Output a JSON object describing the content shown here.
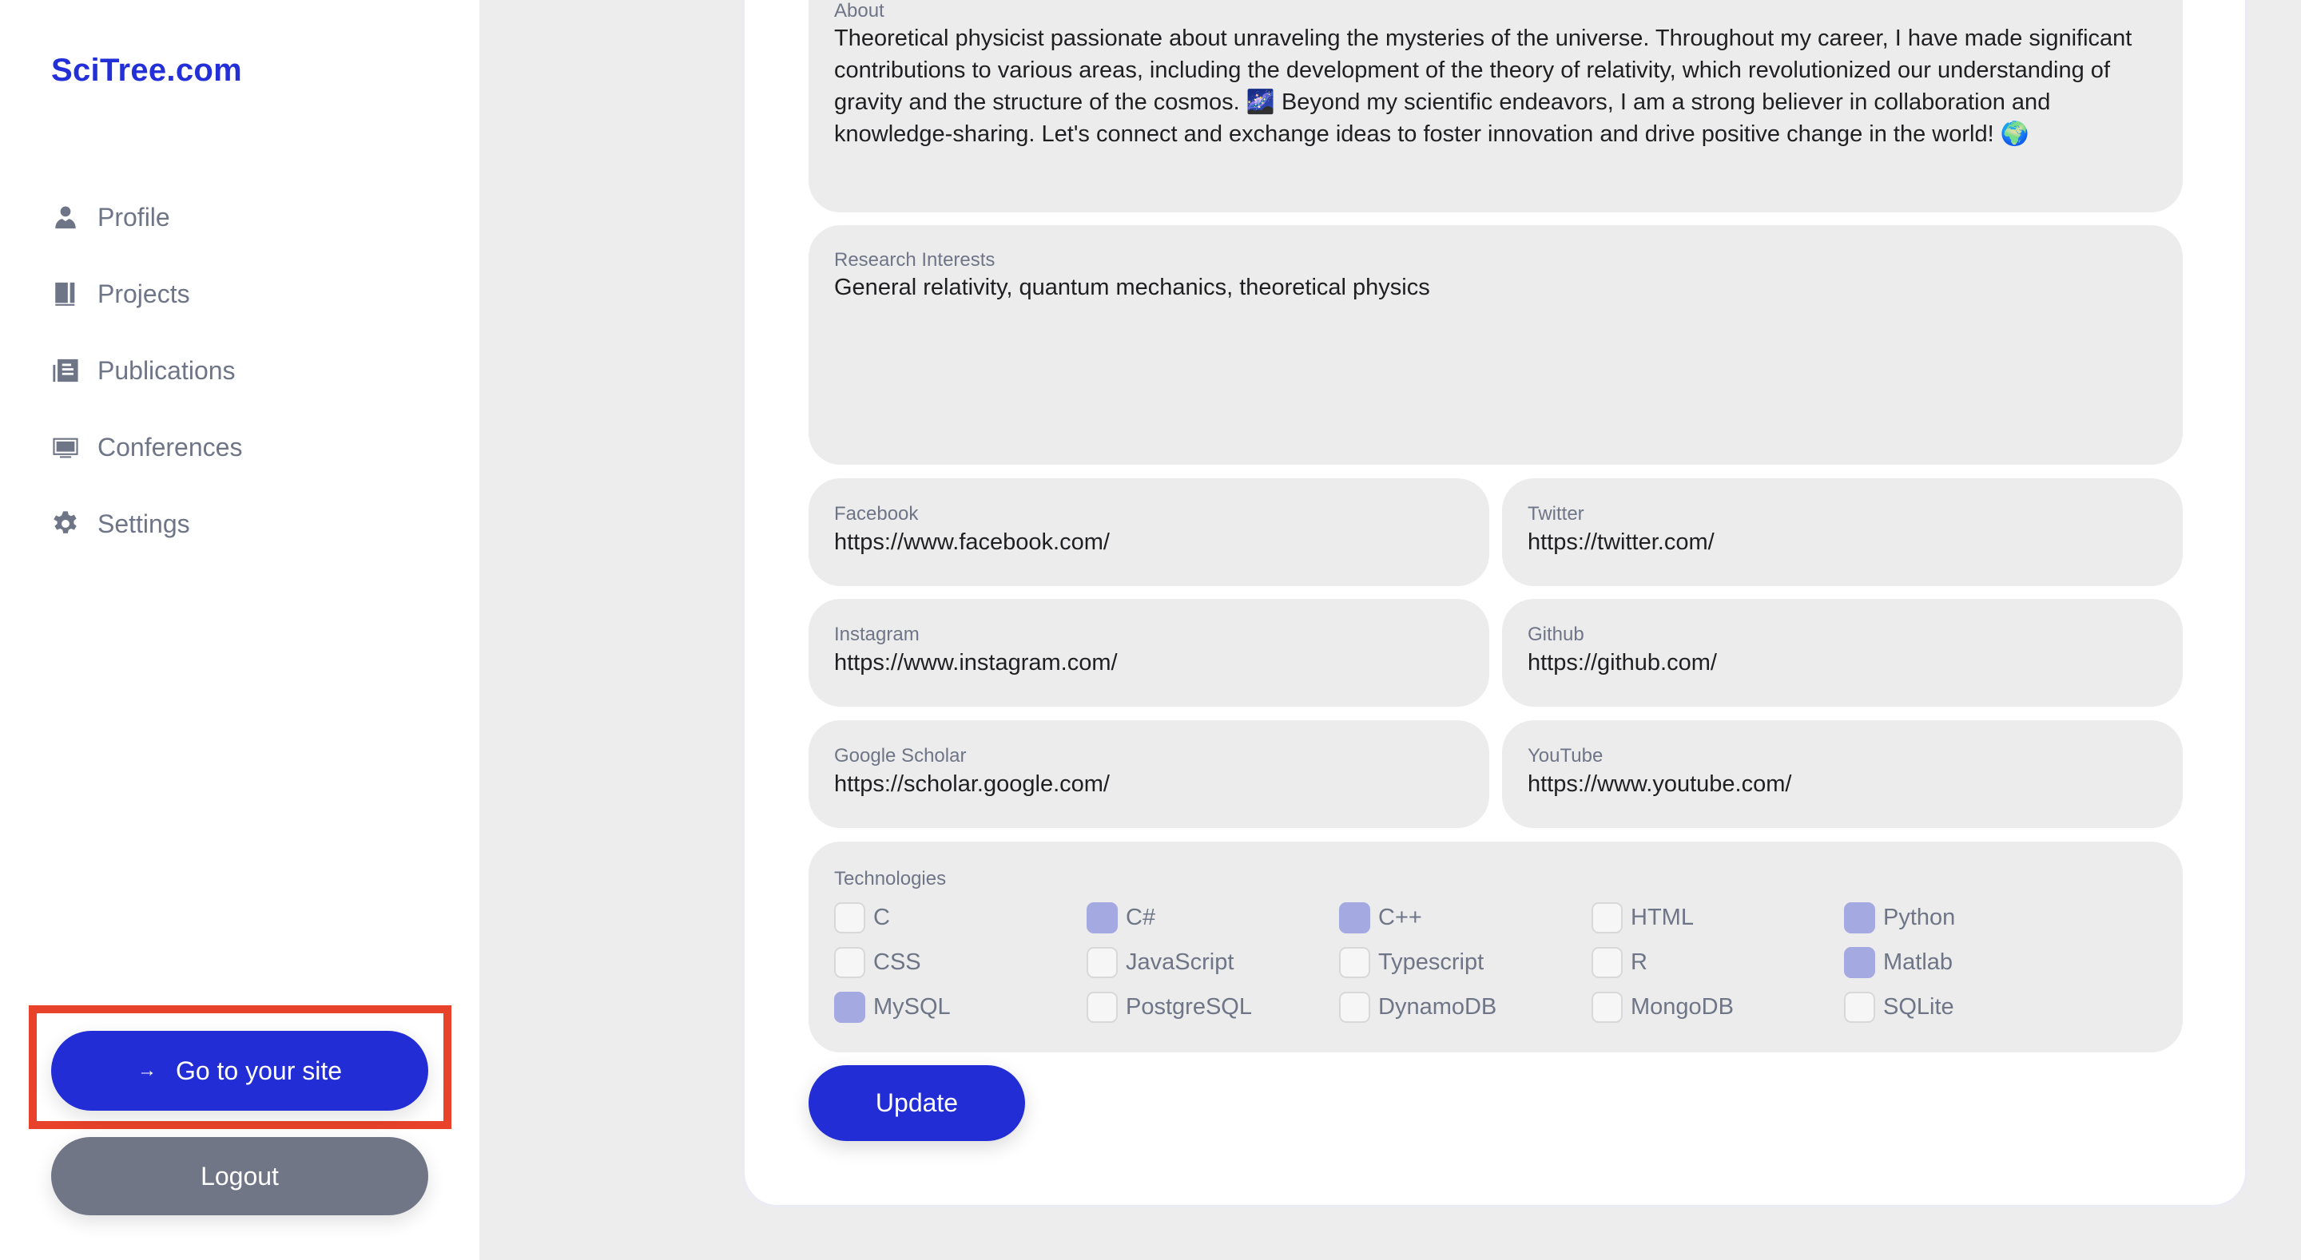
{
  "app": {
    "logo": "SciTree.com",
    "brand_color": "#2330D8"
  },
  "sidebar": {
    "items": [
      {
        "label": "Profile",
        "icon": "person-icon"
      },
      {
        "label": "Projects",
        "icon": "book-icon"
      },
      {
        "label": "Publications",
        "icon": "newspaper-icon"
      },
      {
        "label": "Conferences",
        "icon": "monitor-icon"
      },
      {
        "label": "Settings",
        "icon": "gear-icon"
      }
    ],
    "go_to_site": {
      "arrow": "→",
      "label": "Go to your site"
    },
    "logout": "Logout"
  },
  "form": {
    "about": {
      "label": "About",
      "value": "Theoretical physicist passionate about unraveling the mysteries of the universe. Throughout my career, I have made significant contributions to various areas, including the development of the theory of relativity, which revolutionized our understanding of gravity and the structure of the cosmos. 🌌 Beyond my scientific endeavors, I am a strong believer in collaboration and knowledge-sharing. Let's connect and exchange ideas to foster innovation and drive positive change in the world! 🌍"
    },
    "research": {
      "label": "Research Interests",
      "value": "General relativity, quantum mechanics, theoretical physics"
    },
    "social": {
      "facebook": {
        "label": "Facebook",
        "value": "https://www.facebook.com/"
      },
      "twitter": {
        "label": "Twitter",
        "value": "https://twitter.com/"
      },
      "instagram": {
        "label": "Instagram",
        "value": "https://www.instagram.com/"
      },
      "github": {
        "label": "Github",
        "value": "https://github.com/"
      },
      "scholar": {
        "label": "Google Scholar",
        "value": "https://scholar.google.com/"
      },
      "youtube": {
        "label": "YouTube",
        "value": "https://www.youtube.com/"
      }
    },
    "technologies": {
      "label": "Technologies",
      "items": [
        {
          "name": "C",
          "checked": false
        },
        {
          "name": "C#",
          "checked": true
        },
        {
          "name": "C++",
          "checked": true
        },
        {
          "name": "HTML",
          "checked": false
        },
        {
          "name": "Python",
          "checked": true
        },
        {
          "name": "CSS",
          "checked": false
        },
        {
          "name": "JavaScript",
          "checked": false
        },
        {
          "name": "Typescript",
          "checked": false
        },
        {
          "name": "R",
          "checked": false
        },
        {
          "name": "Matlab",
          "checked": true
        },
        {
          "name": "MySQL",
          "checked": true
        },
        {
          "name": "PostgreSQL",
          "checked": false
        },
        {
          "name": "DynamoDB",
          "checked": false
        },
        {
          "name": "MongoDB",
          "checked": false
        },
        {
          "name": "SQLite",
          "checked": false
        }
      ]
    },
    "update_label": "Update"
  }
}
